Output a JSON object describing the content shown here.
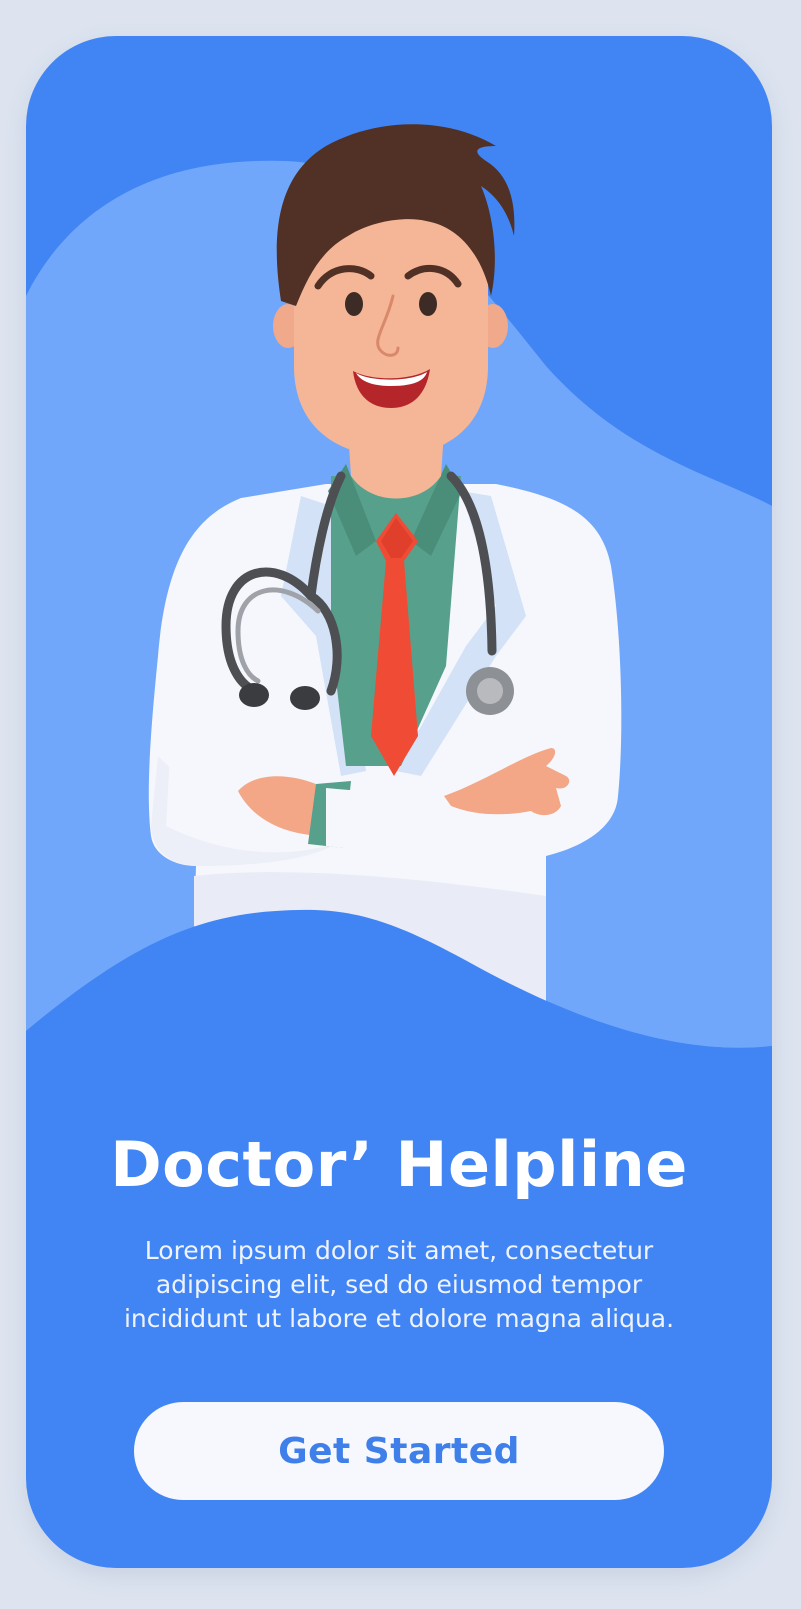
{
  "screen": {
    "title": "Doctor’ Helpline",
    "description": "Lorem ipsum dolor sit amet, consectetur adipiscing elit, sed do eiusmod tempor incididunt ut labore et dolore magna aliqua.",
    "cta_label": "Get Started"
  },
  "colors": {
    "page_background": "#dde4f0",
    "card_background": "#4185f4",
    "wave_light": "#71a7fa",
    "button_background": "#f7f8fd",
    "button_text": "#3e7fe9",
    "hair": "#513125",
    "skin": "#f4b696",
    "coat": "#f6f7fd",
    "shirt": "#57a08b",
    "tie": "#ef4b35",
    "stethoscope": "#4d4f53"
  },
  "illustration": {
    "subject": "doctor-illustration",
    "icons": [
      "stethoscope-icon"
    ]
  }
}
